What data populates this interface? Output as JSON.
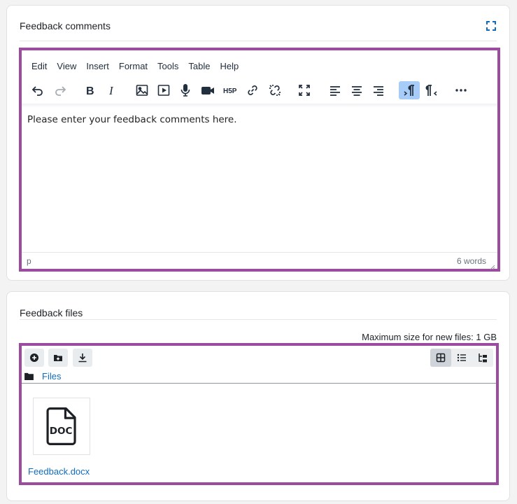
{
  "feedback_comments": {
    "title": "Feedback comments",
    "editor": {
      "menu": [
        "Edit",
        "View",
        "Insert",
        "Format",
        "Tools",
        "Table",
        "Help"
      ],
      "content": "Please enter your feedback comments here.",
      "status_path": "p",
      "word_count": "6 words"
    }
  },
  "feedback_files": {
    "title": "Feedback files",
    "max_size": "Maximum size for new files: 1 GB",
    "path_label": "Files",
    "file": {
      "name": "Feedback.docx",
      "icon_text": "DOC"
    }
  },
  "colors": {
    "frame": "#9b4c9f",
    "link": "#0f6cbf",
    "active_button": "#a6ccf7"
  }
}
